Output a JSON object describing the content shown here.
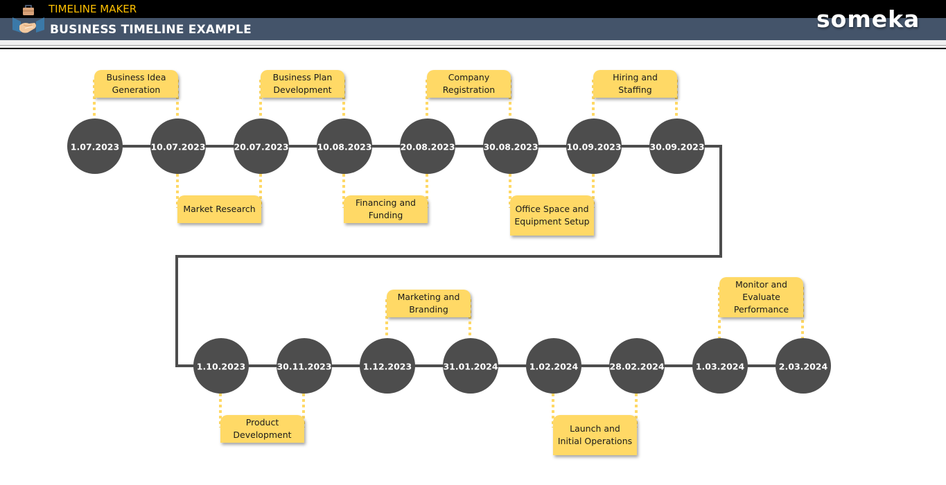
{
  "header": {
    "app_name": "TIMELINE MAKER",
    "page_title": "BUSINESS TIMELINE EXAMPLE",
    "brand": "someka",
    "logo_icon": "handshake-briefcase-icon"
  },
  "colors": {
    "header_black": "#000000",
    "header_slate": "#44546a",
    "app_name": "#ffc000",
    "node_fill": "#4d4d4d",
    "callout_fill": "#ffd966",
    "connector": "#ffd966",
    "track": "#4d4d4d"
  },
  "timeline": {
    "rows": [
      {
        "dates": [
          "1.07.2023",
          "10.07.2023",
          "20.07.2023",
          "10.08.2023",
          "20.08.2023",
          "30.08.2023",
          "10.09.2023",
          "30.09.2023"
        ]
      },
      {
        "dates": [
          "1.10.2023",
          "30.11.2023",
          "1.12.2023",
          "31.01.2024",
          "1.02.2024",
          "28.02.2024",
          "1.03.2024",
          "2.03.2024"
        ]
      }
    ],
    "events": [
      {
        "label": "Business Idea Generation",
        "start": "1.07.2023",
        "end": "10.07.2023",
        "position": "above"
      },
      {
        "label": "Market Research",
        "start": "10.07.2023",
        "end": "20.07.2023",
        "position": "below"
      },
      {
        "label": "Business Plan Development",
        "start": "20.07.2023",
        "end": "10.08.2023",
        "position": "above"
      },
      {
        "label": "Financing and Funding",
        "start": "10.08.2023",
        "end": "20.08.2023",
        "position": "below"
      },
      {
        "label": "Company Registration",
        "start": "20.08.2023",
        "end": "30.08.2023",
        "position": "above"
      },
      {
        "label": "Office Space and Equipment Setup",
        "start": "30.08.2023",
        "end": "10.09.2023",
        "position": "below"
      },
      {
        "label": "Hiring and Staffing",
        "start": "10.09.2023",
        "end": "30.09.2023",
        "position": "above"
      },
      {
        "label": "Product Development",
        "start": "1.10.2023",
        "end": "30.11.2023",
        "position": "below"
      },
      {
        "label": "Marketing and Branding",
        "start": "1.12.2023",
        "end": "31.01.2024",
        "position": "above"
      },
      {
        "label": "Launch and Initial Operations",
        "start": "1.02.2024",
        "end": "28.02.2024",
        "position": "below"
      },
      {
        "label": "Monitor and Evaluate Performance",
        "start": "1.03.2024",
        "end": "2.03.2024",
        "position": "above"
      }
    ]
  }
}
